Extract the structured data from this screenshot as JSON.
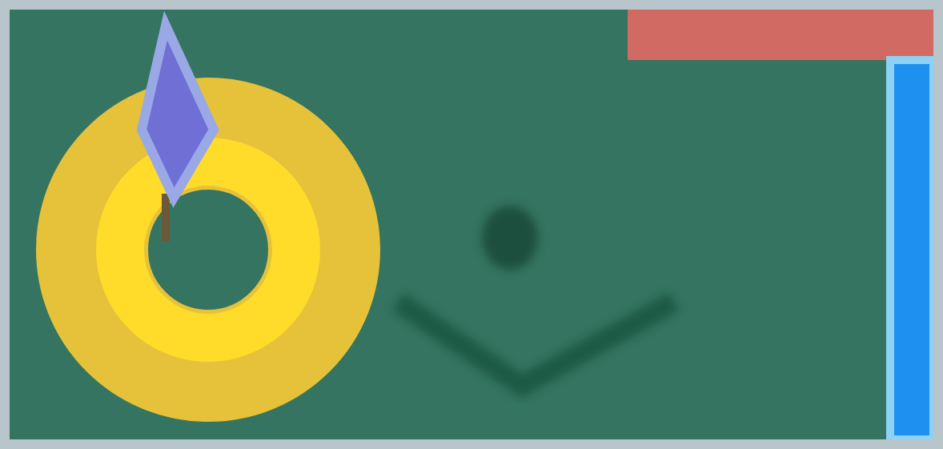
{
  "items": [
    {
      "kind": "ring-arrow"
    },
    {
      "kind": "check"
    },
    {
      "kind": "title-bar"
    },
    {
      "kind": "window-edge"
    }
  ]
}
